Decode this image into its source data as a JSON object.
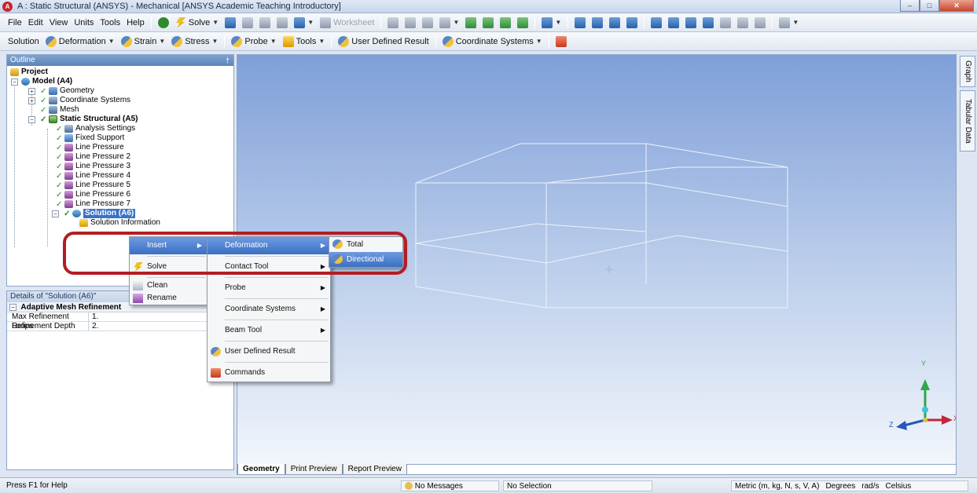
{
  "window": {
    "title": "A : Static Structural (ANSYS) - Mechanical [ANSYS Academic Teaching Introductory]",
    "app_icon": "ansys-logo-icon",
    "buttons": {
      "minimize": "–",
      "maximize": "□",
      "close": "✕"
    }
  },
  "menubar": {
    "items": [
      "File",
      "Edit",
      "View",
      "Units",
      "Tools",
      "Help"
    ],
    "solve_label": "Solve",
    "worksheet_label": "Worksheet"
  },
  "context_toolbar": {
    "items": [
      "Solution",
      "Deformation",
      "Strain",
      "Stress",
      "Probe",
      "Tools",
      "User Defined Result",
      "Coordinate Systems"
    ]
  },
  "outline": {
    "title": "Outline",
    "pin": "†",
    "tree": {
      "project": "Project",
      "model": "Model (A4)",
      "geometry": "Geometry",
      "coordinate_systems": "Coordinate Systems",
      "mesh": "Mesh",
      "static_structural": "Static Structural (A5)",
      "analysis_settings": "Analysis Settings",
      "fixed_support": "Fixed Support",
      "line_pressures": [
        "Line Pressure",
        "Line Pressure 2",
        "Line Pressure 3",
        "Line Pressure 4",
        "Line Pressure 5",
        "Line Pressure 6",
        "Line Pressure 7"
      ],
      "solution": "Solution (A6)",
      "solution_info": "Solution Information"
    }
  },
  "details": {
    "title": "Details of \"Solution (A6)\"",
    "group": "Adaptive Mesh Refinement",
    "rows": [
      {
        "key": "Max Refinement Loops",
        "value": "1."
      },
      {
        "key": "Refinement Depth",
        "value": "2."
      }
    ]
  },
  "context_menu": {
    "main": [
      {
        "label": "Insert",
        "icon": "",
        "submenu": true
      },
      {
        "label": "Solve",
        "icon": "lightning-icon",
        "submenu": false
      },
      {
        "label": "Clean",
        "icon": "eraser-icon",
        "submenu": false
      },
      {
        "label": "Rename",
        "icon": "rename-icon",
        "submenu": false
      }
    ],
    "insert": [
      {
        "label": "Deformation",
        "submenu": true
      },
      {
        "label": "Contact Tool",
        "submenu": true
      },
      {
        "label": "Probe",
        "submenu": true
      },
      {
        "label": "Coordinate Systems",
        "submenu": true
      },
      {
        "label": "Beam Tool",
        "submenu": true
      },
      {
        "label": "User Defined Result",
        "submenu": false
      },
      {
        "label": "Commands",
        "submenu": false
      }
    ],
    "deformation": [
      {
        "label": "Total"
      },
      {
        "label": "Directional"
      }
    ]
  },
  "viewport": {
    "tabs": [
      "Geometry",
      "Print Preview",
      "Report Preview"
    ],
    "active_tab": "Geometry",
    "axes": {
      "x": "X",
      "y": "Y",
      "z": "Z"
    }
  },
  "side_tabs": [
    "Graph",
    "Tabular Data"
  ],
  "statusbar": {
    "help": "Press F1 for Help",
    "messages": "No Messages",
    "selection": "No Selection",
    "units": "Metric (m, kg, N, s, V, A)",
    "angle": "Degrees",
    "rot_velocity": "rad/s",
    "temperature": "Celsius"
  },
  "colors": {
    "callout": "#b31d23",
    "menu_highlight": "#3b6fc4",
    "viewport_top": "#7f9fd9",
    "viewport_bottom": "#f2f6fc"
  }
}
